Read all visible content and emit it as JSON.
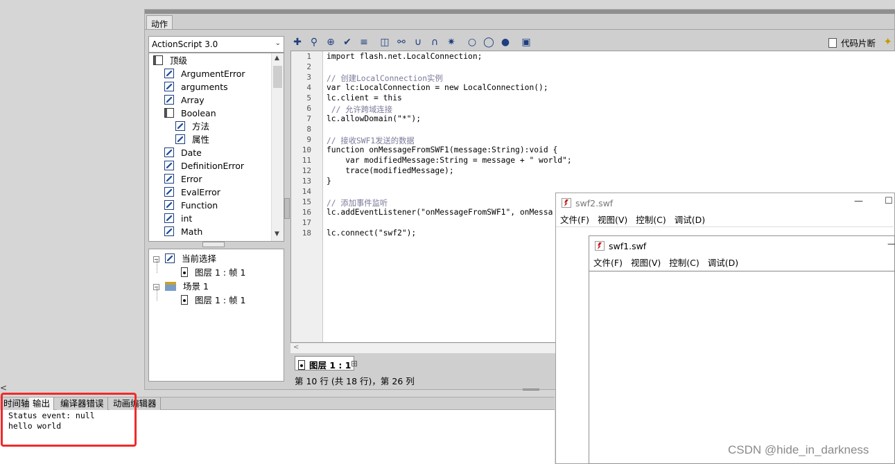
{
  "actions_panel": {
    "tab_label": "动作",
    "language_select": "ActionScript 3.0",
    "library_tree": [
      {
        "label": "顶级",
        "icon": "book-icon",
        "indent": 0
      },
      {
        "label": "ArgumentError",
        "icon": "class-icon",
        "indent": 1
      },
      {
        "label": "arguments",
        "icon": "class-icon",
        "indent": 1
      },
      {
        "label": "Array",
        "icon": "class-icon",
        "indent": 1
      },
      {
        "label": "Boolean",
        "icon": "book-icon",
        "indent": 1
      },
      {
        "label": "方法",
        "icon": "class-icon",
        "indent": 2
      },
      {
        "label": "属性",
        "icon": "class-icon",
        "indent": 2
      },
      {
        "label": "Date",
        "icon": "class-icon",
        "indent": 1
      },
      {
        "label": "DefinitionError",
        "icon": "class-icon",
        "indent": 1
      },
      {
        "label": "Error",
        "icon": "class-icon",
        "indent": 1
      },
      {
        "label": "EvalError",
        "icon": "class-icon",
        "indent": 1
      },
      {
        "label": "Function",
        "icon": "class-icon",
        "indent": 1
      },
      {
        "label": "int",
        "icon": "class-icon",
        "indent": 1
      },
      {
        "label": "Math",
        "icon": "class-icon",
        "indent": 1
      }
    ],
    "script_navigator": {
      "current_selection": "当前选择",
      "current_frame": "图层 1 : 帧 1",
      "scene": "场景 1",
      "scene_frame": "图层 1 : 帧 1"
    },
    "toolbar": {
      "icons": [
        "add-icon",
        "find-icon",
        "target-icon",
        "check-syntax-icon",
        "auto-format-icon",
        "code-hint-icon",
        "debug-options-icon",
        "collapse-braces-icon",
        "collapse-selection-icon",
        "expand-all-icon",
        "apply-comment-icon",
        "apply-line-comment-icon",
        "remove-comment-icon",
        "show-hide-toolbox-icon"
      ],
      "code_snippets_label": "代码片断"
    },
    "code_lines": [
      "import flash.net.LocalConnection;",
      "",
      "// 创建LocalConnection实例",
      "var lc:LocalConnection = new LocalConnection();",
      "lc.client = this",
      " // 允许跨域连接",
      "lc.allowDomain(\"*\");",
      "",
      "// 接收SWF1发送的数据",
      "function onMessageFromSWF1(message:String):void {",
      "    var modifiedMessage:String = message + \" world\";",
      "    trace(modifiedMessage);",
      "}",
      "",
      "// 添加事件监听",
      "lc.addEventListener(\"onMessageFromSWF1\", onMessa",
      "",
      "lc.connect(\"swf2\");"
    ],
    "layer_tab": "图层 1 : 1",
    "status_line": "第 10 行 (共 18 行)，第 26 列"
  },
  "bottom_panel": {
    "tabs": [
      "时间轴",
      "输出",
      "编译器错误",
      "动画编辑器"
    ],
    "active_tab": "输出",
    "output_lines": [
      "Status event: null",
      "hello world"
    ]
  },
  "swf2_window": {
    "title": "swf2.swf",
    "menu": [
      "文件(F)",
      "视图(V)",
      "控制(C)",
      "调试(D)"
    ]
  },
  "swf1_window": {
    "title": "swf1.swf",
    "menu": [
      "文件(F)",
      "视图(V)",
      "控制(C)",
      "调试(D)"
    ]
  },
  "watermark": "CSDN @hide_in_darkness",
  "colors": {
    "highlight": "#f02a2a",
    "keyword": "#0033cc",
    "string": "#009900",
    "comment": "#7a7a9a"
  }
}
